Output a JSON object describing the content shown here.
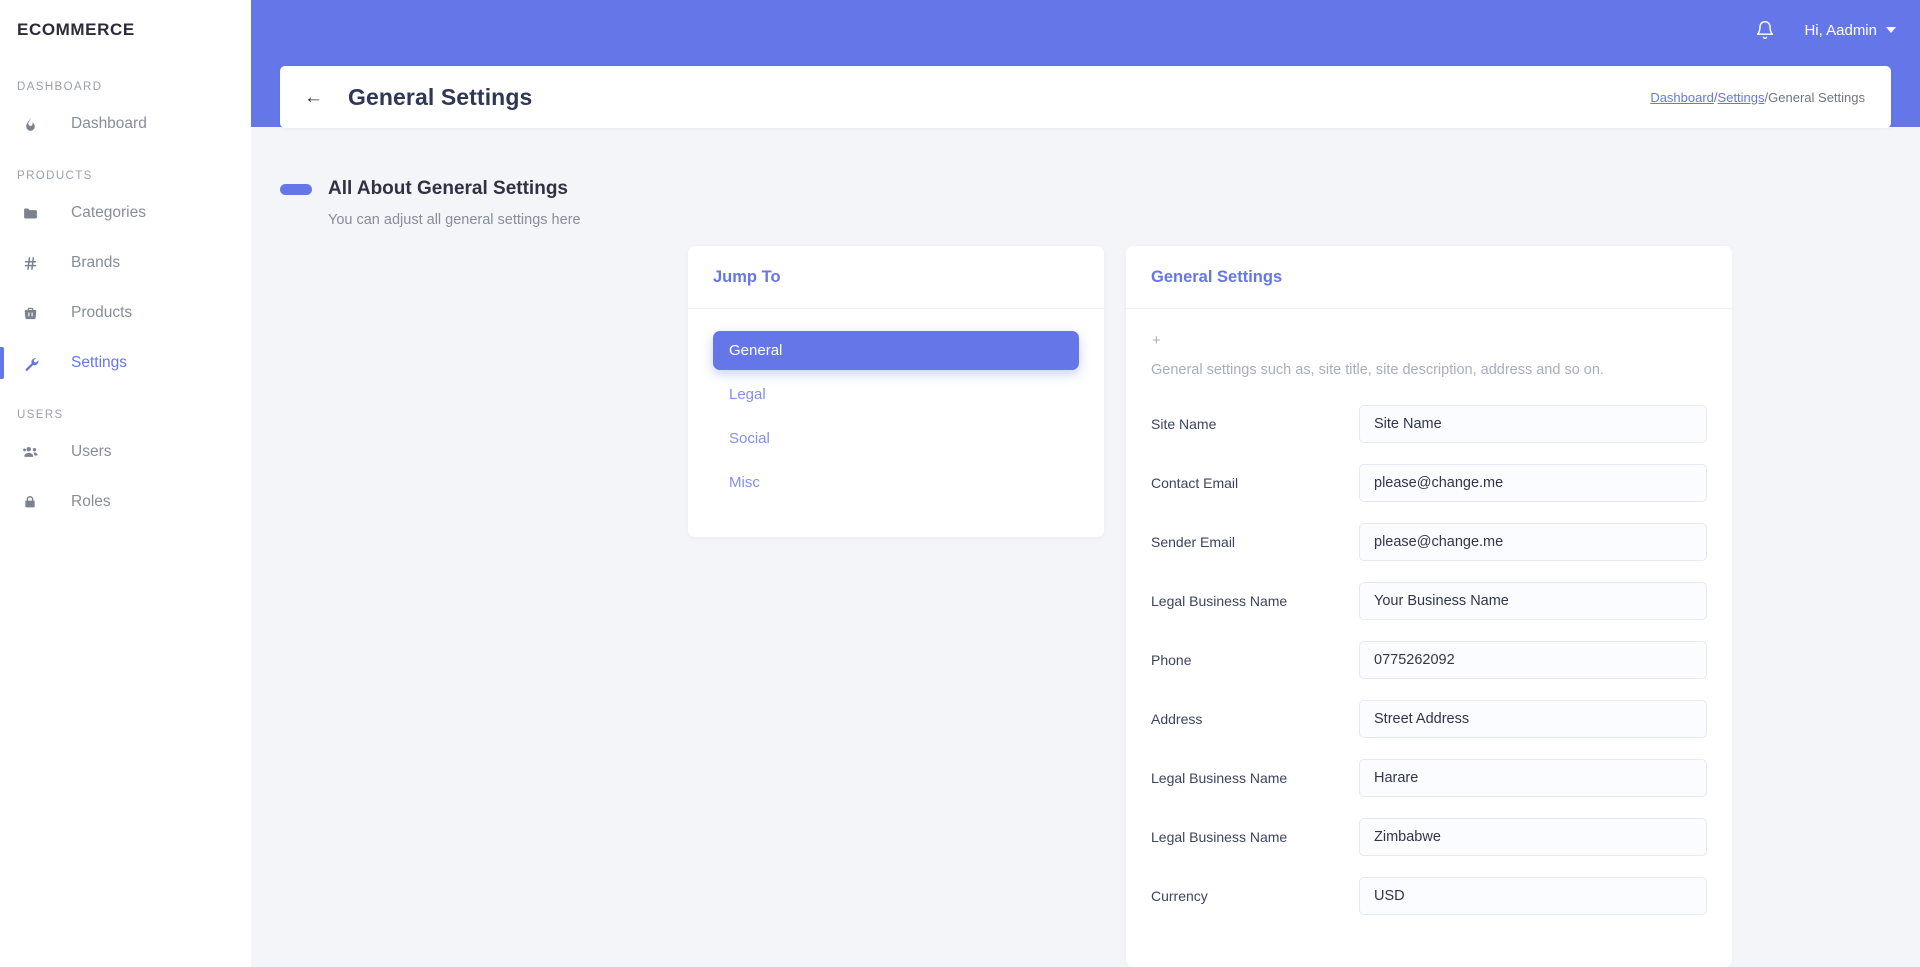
{
  "brand": {
    "name": "ECOMMERCE"
  },
  "sidebar": {
    "sections": [
      {
        "title": "DASHBOARD",
        "items": [
          {
            "label": "Dashboard",
            "icon": "fire-icon",
            "active": false
          }
        ]
      },
      {
        "title": "PRODUCTS",
        "items": [
          {
            "label": "Categories",
            "icon": "folder-icon",
            "active": false
          },
          {
            "label": "Brands",
            "icon": "hash-icon",
            "active": false
          },
          {
            "label": "Products",
            "icon": "basket-icon",
            "active": false
          },
          {
            "label": "Settings",
            "icon": "wrench-icon",
            "active": true
          }
        ]
      },
      {
        "title": "USERS",
        "items": [
          {
            "label": "Users",
            "icon": "users-icon",
            "active": false
          },
          {
            "label": "Roles",
            "icon": "lock-icon",
            "active": false
          }
        ]
      }
    ]
  },
  "topbar": {
    "bell_icon": "bell-icon",
    "user_greeting": "Hi, Aadmin",
    "caret_icon": "chevron-down-icon"
  },
  "titlebar": {
    "back_icon": "arrow-left-icon",
    "title": "General Settings",
    "breadcrumb": {
      "dashboard": "Dashboard",
      "settings": "Settings",
      "current": "General Settings",
      "separator": "/"
    }
  },
  "section": {
    "title": "All About General Settings",
    "subtitle": "You can adjust all general settings here"
  },
  "jump_to": {
    "header": "Jump To",
    "items": [
      {
        "label": "General",
        "active": true
      },
      {
        "label": "Legal",
        "active": false
      },
      {
        "label": "Social",
        "active": false
      },
      {
        "label": "Misc",
        "active": false
      }
    ]
  },
  "general_settings": {
    "header": "General Settings",
    "plus": "+",
    "description": "General settings such as, site title, site description, address and so on.",
    "fields": [
      {
        "label": "Site Name",
        "value": "Site Name"
      },
      {
        "label": "Contact Email",
        "value": "please@change.me"
      },
      {
        "label": "Sender Email",
        "value": "please@change.me"
      },
      {
        "label": "Legal Business Name",
        "value": "Your Business Name"
      },
      {
        "label": "Phone",
        "value": "0775262092"
      },
      {
        "label": "Address",
        "value": "Street Address"
      },
      {
        "label": "Legal Business Name",
        "value": "Harare"
      },
      {
        "label": "Legal Business Name",
        "value": "Zimbabwe"
      },
      {
        "label": "Currency",
        "value": "USD"
      }
    ]
  },
  "colors": {
    "accent": "#6577e8",
    "page_background": "#f4f5f9",
    "card_background": "#ffffff",
    "label_text": "#3c4461",
    "muted_text": "#868e99"
  }
}
